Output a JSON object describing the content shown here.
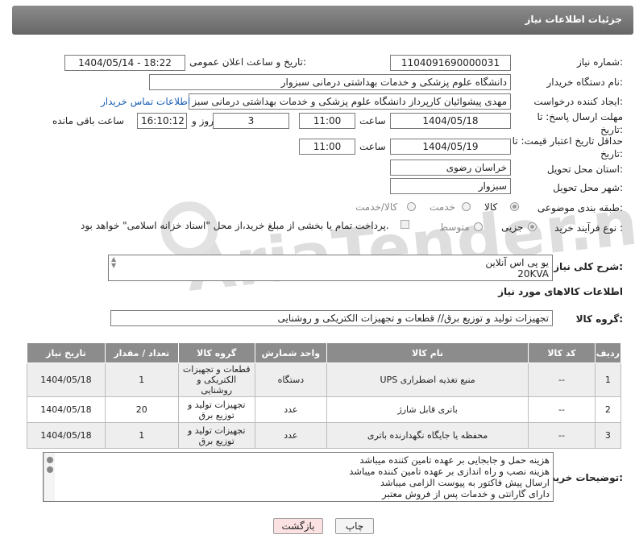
{
  "header": {
    "title": "جزئیات اطلاعات نیاز"
  },
  "fields": {
    "need_number": {
      "label": "شماره نیاز:",
      "value": "1104091690000031"
    },
    "announce": {
      "label": "تاریخ و ساعت اعلان عمومی:",
      "value": "1404/05/14 - 18:22"
    },
    "buyer_org": {
      "label": "نام دستگاه خریدار:",
      "value": "دانشگاه علوم پزشکی و خدمات بهداشتی  درمانی سبزوار"
    },
    "requester": {
      "label": "ایجاد کننده درخواست:",
      "value": "مهدی پیشوائیان کارپرداز دانشگاه علوم پزشکی و خدمات بهداشتی  درمانی سبز",
      "contact_link": "اطلاعات تماس خریدار"
    },
    "reply_deadline": {
      "label": "مهلت ارسال پاسخ: تا تاریخ:",
      "date": "1404/05/18",
      "time_label": "ساعت",
      "time": "11:00",
      "days": "3",
      "days_label": "روز و",
      "remaining": "16:10:12",
      "remaining_label": "ساعت باقی مانده"
    },
    "price_validity": {
      "label": "حداقل تاریخ اعتبار قیمت: تا تاریخ:",
      "date": "1404/05/19",
      "time_label": "ساعت",
      "time": "11:00"
    },
    "province": {
      "label": "استان محل تحویل:",
      "value": "خراسان رضوی"
    },
    "city": {
      "label": "شهر محل تحویل:",
      "value": "سبزوار"
    },
    "category": {
      "label": "طبقه بندی موضوعی:",
      "options": [
        "کالا",
        "خدمت",
        "کالا/خدمت"
      ],
      "selected": "کالا"
    },
    "process": {
      "label": "نوع فرآیند خرید :",
      "options": [
        "جزیی",
        "متوسط"
      ],
      "selected": "جزیی",
      "note": "پرداخت تمام یا بخشی از مبلغ خرید،از محل \"اسناد خزانه اسلامی\" خواهد بود."
    }
  },
  "description": {
    "label": "شرح کلی نیاز:",
    "line1": "یو پی اس آنلاین",
    "line2": "20KVA"
  },
  "goods_section": {
    "title": "اطلاعات کالاهای مورد نیاز",
    "group_label": "گروه کالا:",
    "group_value": "تجهیزات تولید و توزیع برق// قطعات و تجهیزات الکتریکی و روشنایی"
  },
  "table": {
    "headers": [
      "ردیف",
      "کد کالا",
      "نام کالا",
      "واحد شمارش",
      "گروه کالا",
      "تعداد / مقدار",
      "تاریخ نیاز"
    ],
    "rows": [
      {
        "row": "1",
        "code": "--",
        "name": "منبع تغذیه اضطراری UPS",
        "unit": "دستگاه",
        "group": "قطعات و تجهیزات الکتریکی و روشنایی",
        "qty": "1",
        "date": "1404/05/18"
      },
      {
        "row": "2",
        "code": "--",
        "name": "باتری قابل شارژ",
        "unit": "عدد",
        "group": "تجهیزات تولید و توزیع برق",
        "qty": "20",
        "date": "1404/05/18"
      },
      {
        "row": "3",
        "code": "--",
        "name": "محفظه یا جایگاه نگهدارنده باتری",
        "unit": "عدد",
        "group": "تجهیزات تولید و توزیع برق",
        "qty": "1",
        "date": "1404/05/18"
      }
    ]
  },
  "buyer_notes": {
    "label": "توضیحات خریدار:",
    "lines": [
      "هزینه حمل و جابجایی بر عهده تامین کننده میباشد",
      "هزینه نصب و راه اندازی بر عهده تامین کننده میباشد",
      "ارسال پیش فاکتور به پیوست الزامی میباشد",
      "دارای گارانتی و خدمات پس از فروش معتبر"
    ]
  },
  "buttons": {
    "print": "چاپ",
    "back": "بازگشت"
  },
  "watermark": {
    "text": "AriaTender.neT"
  }
}
